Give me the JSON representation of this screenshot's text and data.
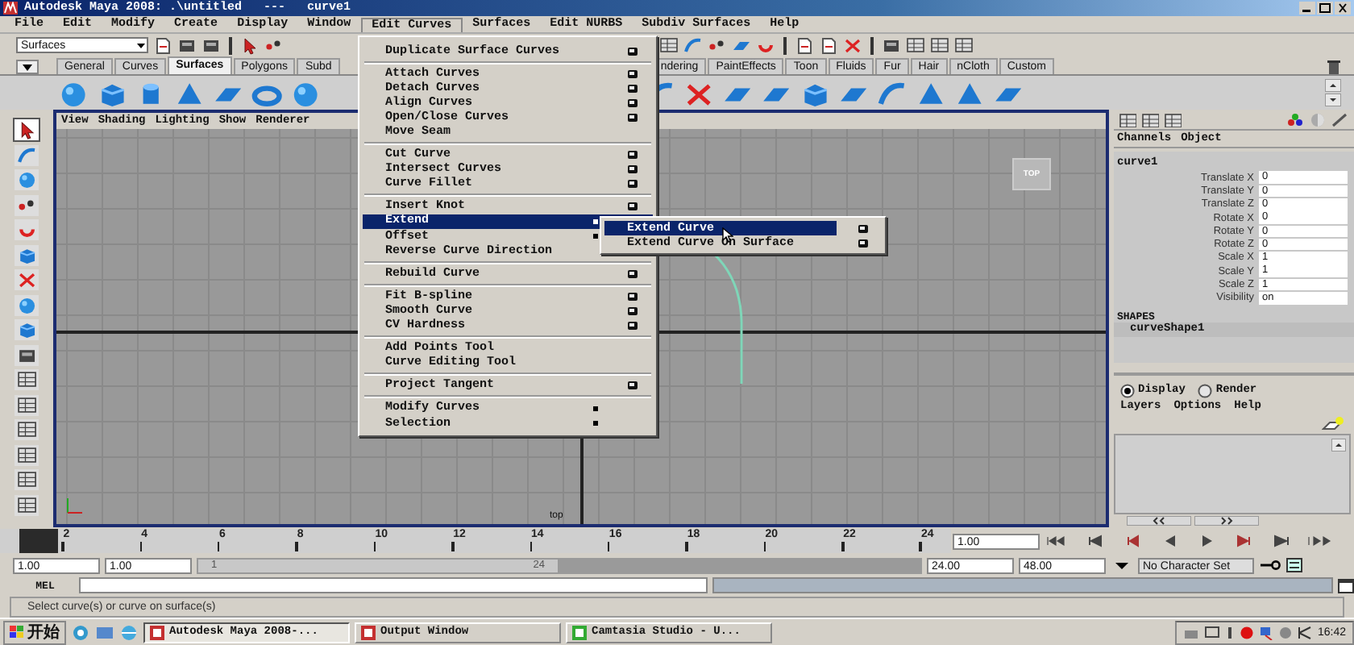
{
  "window": {
    "title": "Autodesk Maya 2008: .\\untitled   ---   curve1"
  },
  "menubar": [
    {
      "label": "File",
      "selected": false
    },
    {
      "label": "Edit",
      "selected": false
    },
    {
      "label": "Modify",
      "selected": false
    },
    {
      "label": "Create",
      "selected": false
    },
    {
      "label": "Display",
      "selected": false
    },
    {
      "label": "Window",
      "selected": false
    },
    {
      "label": "Edit Curves",
      "selected": true
    },
    {
      "label": "Surfaces",
      "selected": false
    },
    {
      "label": "Edit NURBS",
      "selected": false
    },
    {
      "label": "Subdiv Surfaces",
      "selected": false
    },
    {
      "label": "Help",
      "selected": false
    }
  ],
  "toolbar": {
    "menu_set": "Surfaces"
  },
  "shelf_tabs_left": [
    {
      "label": "General",
      "selected": false
    },
    {
      "label": "Curves",
      "selected": false
    },
    {
      "label": "Surfaces",
      "selected": true
    },
    {
      "label": "Polygons",
      "selected": false
    },
    {
      "label": "Subd",
      "selected": false
    }
  ],
  "shelf_tabs_right": [
    {
      "label": "ndering",
      "selected": false
    },
    {
      "label": "PaintEffects",
      "selected": false
    },
    {
      "label": "Toon",
      "selected": false
    },
    {
      "label": "Fluids",
      "selected": false
    },
    {
      "label": "Fur",
      "selected": false
    },
    {
      "label": "Hair",
      "selected": false
    },
    {
      "label": "nCloth",
      "selected": false
    },
    {
      "label": "Custom",
      "selected": false
    }
  ],
  "panel_menu": [
    "View",
    "Shading",
    "Lighting",
    "Show",
    "Renderer"
  ],
  "viewport": {
    "view_cube_label": "TOP",
    "camera_label": "top"
  },
  "edit_curves_menu": [
    [
      {
        "label": "Duplicate Surface Curves",
        "option_box": true,
        "submenu": false,
        "selected": false
      }
    ],
    [
      {
        "label": "Attach Curves",
        "option_box": true,
        "submenu": false,
        "selected": false
      },
      {
        "label": "Detach Curves",
        "option_box": true,
        "submenu": false,
        "selected": false
      },
      {
        "label": "Align Curves",
        "option_box": true,
        "submenu": false,
        "selected": false
      },
      {
        "label": "Open/Close Curves",
        "option_box": true,
        "submenu": false,
        "selected": false
      },
      {
        "label": "Move Seam",
        "option_box": false,
        "submenu": false,
        "selected": false
      }
    ],
    [
      {
        "label": "Cut Curve",
        "option_box": true,
        "submenu": false,
        "selected": false
      },
      {
        "label": "Intersect Curves",
        "option_box": true,
        "submenu": false,
        "selected": false
      },
      {
        "label": "Curve Fillet",
        "option_box": true,
        "submenu": false,
        "selected": false
      }
    ],
    [
      {
        "label": "Insert Knot",
        "option_box": true,
        "submenu": false,
        "selected": false
      },
      {
        "label": "Extend",
        "option_box": false,
        "submenu": true,
        "selected": true
      },
      {
        "label": "Offset",
        "option_box": false,
        "submenu": true,
        "selected": false
      },
      {
        "label": "Reverse Curve Direction",
        "option_box": false,
        "submenu": false,
        "selected": false
      }
    ],
    [
      {
        "label": "Rebuild Curve",
        "option_box": true,
        "submenu": false,
        "selected": false
      }
    ],
    [
      {
        "label": "Fit B-spline",
        "option_box": true,
        "submenu": false,
        "selected": false
      },
      {
        "label": "Smooth Curve",
        "option_box": true,
        "submenu": false,
        "selected": false
      },
      {
        "label": "CV Hardness",
        "option_box": true,
        "submenu": false,
        "selected": false
      }
    ],
    [
      {
        "label": "Add Points Tool",
        "option_box": false,
        "submenu": false,
        "selected": false
      },
      {
        "label": "Curve Editing Tool",
        "option_box": false,
        "submenu": false,
        "selected": false
      }
    ],
    [
      {
        "label": "Project Tangent",
        "option_box": true,
        "submenu": false,
        "selected": false
      }
    ],
    [
      {
        "label": "Modify Curves",
        "option_box": false,
        "submenu": true,
        "selected": false
      },
      {
        "label": "Selection",
        "option_box": false,
        "submenu": true,
        "selected": false
      }
    ]
  ],
  "extend_submenu": [
    {
      "label": "Extend Curve",
      "option_box": true,
      "selected": true
    },
    {
      "label": "Extend Curve On Surface",
      "option_box": true,
      "selected": false
    }
  ],
  "channel_box": {
    "tabs": [
      "Channels",
      "Object"
    ],
    "node": "curve1",
    "attributes": [
      {
        "name": "Translate X",
        "value": "0"
      },
      {
        "name": "Translate Y",
        "value": "0"
      },
      {
        "name": "Translate Z",
        "value": "0"
      },
      {
        "name": "Rotate X",
        "value": "0"
      },
      {
        "name": "Rotate Y",
        "value": "0"
      },
      {
        "name": "Rotate Z",
        "value": "0"
      },
      {
        "name": "Scale X",
        "value": "1"
      },
      {
        "name": "Scale Y",
        "value": "1"
      },
      {
        "name": "Scale Z",
        "value": "1"
      },
      {
        "name": "Visibility",
        "value": "on"
      }
    ],
    "shapes_heading": "SHAPES",
    "shape": "curveShape1"
  },
  "layer_editor": {
    "modes": [
      {
        "label": "Display",
        "selected": true
      },
      {
        "label": "Render",
        "selected": false
      }
    ],
    "menu": [
      "Layers",
      "Options",
      "Help"
    ]
  },
  "time_slider": {
    "level": 0,
    "ticks": [
      "2",
      "4",
      "6",
      "8",
      "10",
      "12",
      "14",
      "16",
      "18",
      "20",
      "22",
      "24"
    ],
    "current_frame": "1.00"
  },
  "range_slider": {
    "level": 0.5,
    "start": "1.00",
    "playback_start": "1.00",
    "range_start_label": "1",
    "range_end_label": "24",
    "playback_end": "24.00",
    "end": "48.00",
    "character_set": "No Character Set"
  },
  "command_line": {
    "label": "MEL"
  },
  "help_line": "Select curve(s) or curve on surface(s)",
  "taskbar": {
    "start": "开始",
    "tasks": [
      {
        "label": "Autodesk Maya 2008-...",
        "selected": true
      },
      {
        "label": "Output Window",
        "selected": false
      },
      {
        "label": "Camtasia Studio - U...",
        "selected": false
      }
    ],
    "clock": "16:42"
  }
}
